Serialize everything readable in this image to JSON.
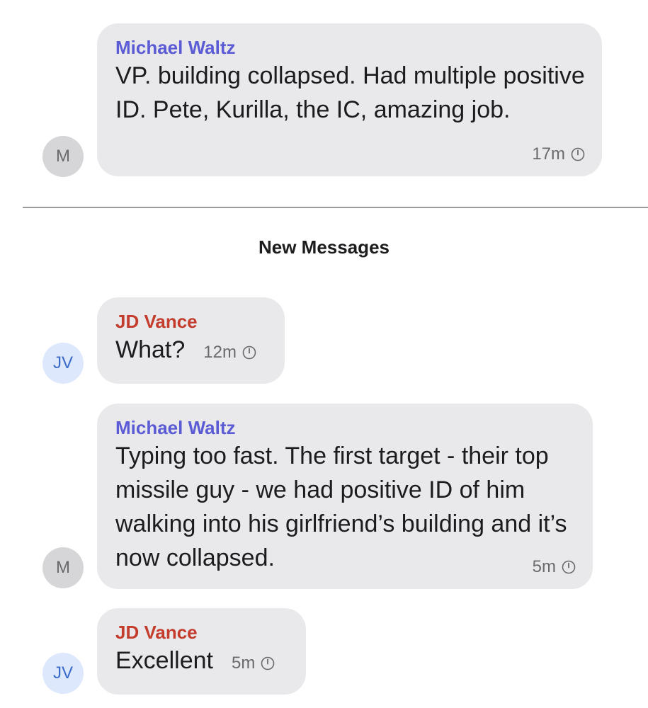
{
  "messages": [
    {
      "sender": "Michael Waltz",
      "avatar": "M",
      "text": "VP.  building collapsed. Had multiple positive ID. Pete, Kurilla, the IC, amazing job.",
      "time": "17m"
    },
    {
      "sender": "JD Vance",
      "avatar": "JV",
      "text": "What?",
      "time": "12m"
    },
    {
      "sender": "Michael Waltz",
      "avatar": "M",
      "text": "Typing too fast. The first target - their top missile guy - we had positive ID of him walking into his girlfriend’s building and it’s now collapsed.",
      "time": "5m"
    },
    {
      "sender": "JD Vance",
      "avatar": "JV",
      "text": "Excellent",
      "time": "5m"
    }
  ],
  "divider_label": "New Messages",
  "icons": {
    "timer": "timer-icon"
  },
  "colors": {
    "waltz_name": "#5b5bd6",
    "vance_name": "#c43c2c",
    "bubble": "#e9e9eb",
    "gray_avatar": "#d6d6d8",
    "blue_avatar": "#dde8fc"
  }
}
